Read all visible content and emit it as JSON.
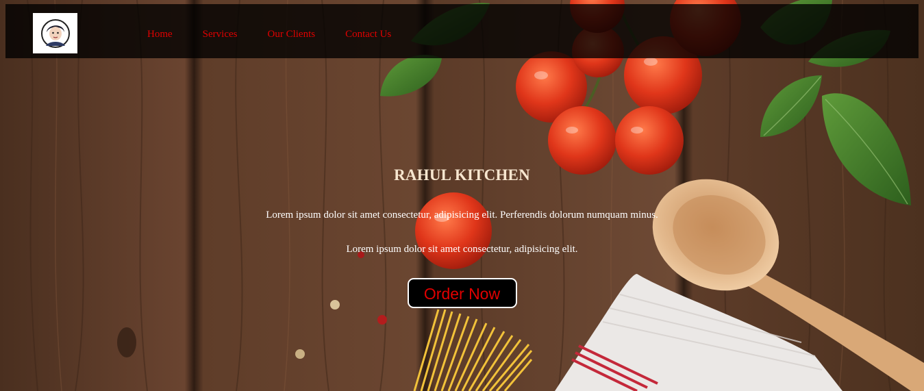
{
  "nav": {
    "logo_alt": "Rahul avatar logo",
    "links": [
      {
        "label": "Home"
      },
      {
        "label": "Services"
      },
      {
        "label": "Our Clients"
      },
      {
        "label": "Contact Us"
      }
    ]
  },
  "hero": {
    "title": "RAHUL KITCHEN",
    "paragraph_1": "Lorem ipsum dolor sit amet consectetur, adipisicing elit. Perferendis dolorum numquam minus.",
    "paragraph_2": "Lorem ipsum dolor sit amet consectetur, adipisicing elit.",
    "button_label": "Order Now"
  },
  "colors": {
    "nav_link": "#e10000",
    "title": "#f7e6cf",
    "button_bg": "#000000",
    "button_text": "#e10000",
    "wood": "#5b3a26"
  }
}
